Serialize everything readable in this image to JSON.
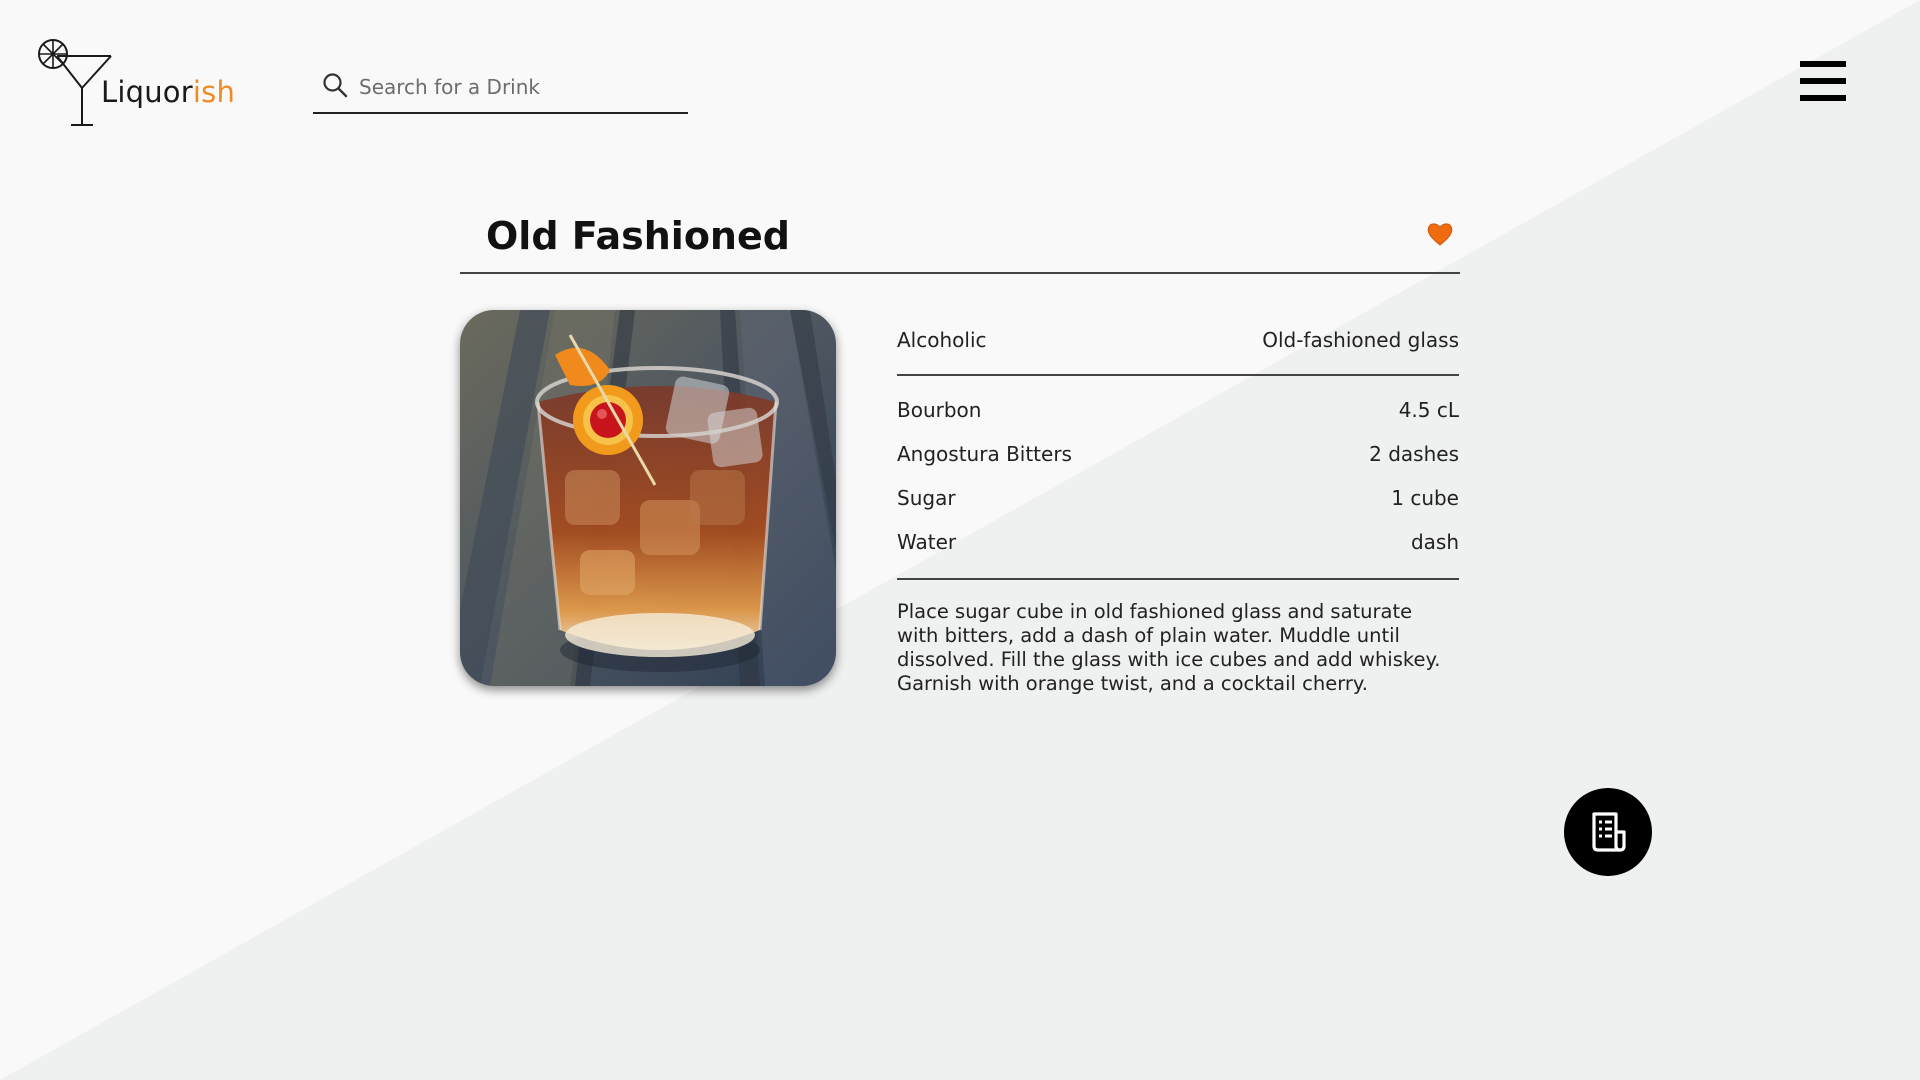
{
  "app": {
    "logo_text_main": "Liquor",
    "logo_text_accent": "ish",
    "accent_color": "#f08a24"
  },
  "search": {
    "placeholder": "Search for a Drink",
    "value": "",
    "icon": "search-icon"
  },
  "menu": {
    "icon": "hamburger-menu-icon"
  },
  "drink": {
    "name": "Old Fashioned",
    "favorite_icon": "heart-icon",
    "favorite_color": "#f06a10",
    "type": "Alcoholic",
    "glass": "Old-fashioned glass",
    "ingredients": [
      {
        "name": "Bourbon",
        "amount": "4.5 cL"
      },
      {
        "name": "Angostura Bitters",
        "amount": "2 dashes"
      },
      {
        "name": "Sugar",
        "amount": "1 cube"
      },
      {
        "name": "Water",
        "amount": "dash"
      }
    ],
    "instructions": "Place sugar cube in old fashioned glass and saturate with bitters, add a dash of plain water. Muddle until dissolved. Fill the glass with ice cubes and add whiskey. Garnish with orange twist, and a cocktail cherry."
  },
  "fab": {
    "icon": "recipe-document-icon"
  }
}
